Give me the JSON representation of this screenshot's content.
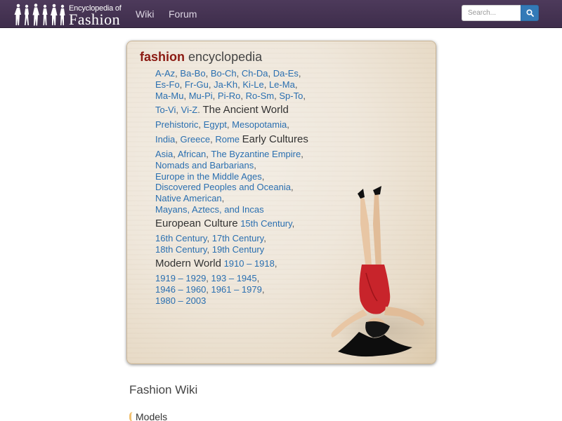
{
  "brand": {
    "line1": "Encyclopedia of",
    "line2": "Fashion"
  },
  "nav": {
    "wiki": "Wiki",
    "forum": "Forum"
  },
  "search": {
    "placeholder": "Search...",
    "icon": "search-icon"
  },
  "colors": {
    "nav_bg": "#4d3a5b",
    "link": "#2a6fb0",
    "title_accent": "#8b1a12",
    "search_button": "#337ab7"
  },
  "panel": {
    "title_bold": "fashion",
    "title_rest": "encyclopedia",
    "sep": {
      "comma": ",",
      "dot": ".",
      "space": " "
    },
    "alpha": [
      "A-Az",
      "Ba-Bo",
      "Bo-Ch",
      "Ch-Da",
      "Da-Es",
      "Es-Fo",
      "Fr-Gu",
      "Ja-Kh",
      "Ki-Le",
      "Le-Ma",
      "Ma-Mu",
      "Mu-Pi",
      "Pi-Ro",
      "Ro-Sm",
      "Sp-To",
      "To-Vi",
      "Vi-Z"
    ],
    "ancient": {
      "heading": "The Ancient World",
      "links": [
        "Prehistoric",
        "Egypt",
        "Mesopotamia",
        "India",
        "Greece",
        "Rome"
      ]
    },
    "early": {
      "heading": "Early Cultures",
      "links": [
        "Asia",
        "African",
        "The Byzantine Empire",
        "Nomads and Barbarians",
        "Europe in the Middle Ages",
        "Discovered Peoples and Oceania",
        "Native American",
        "Mayans, Aztecs, and Incas"
      ]
    },
    "european": {
      "heading": "European Culture",
      "links": [
        "15th Century",
        "16th Century",
        "17th Century",
        "18th Century",
        "19th Century"
      ]
    },
    "modern": {
      "heading": "Modern World",
      "links": [
        "1910 – 1918",
        "1919 – 1929",
        "193 – 1945",
        "1946 – 1960",
        "1961 – 1979",
        "1980 – 2003"
      ]
    }
  },
  "wiki": {
    "title": "Fashion Wiki",
    "first_item": "Models"
  }
}
